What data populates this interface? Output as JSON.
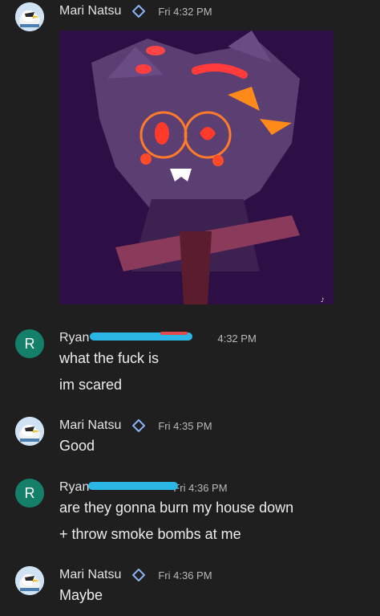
{
  "messages": [
    {
      "sender": "Mari Natsu",
      "time": "Fri 4:32 PM",
      "avatar": "bird-avatar",
      "verified": true,
      "lines": [],
      "attachment": "image"
    },
    {
      "sender": "Ryan",
      "time": "4:32 PM",
      "avatar_letter": "R",
      "lines": [
        "what the fuck is",
        "im scared"
      ]
    },
    {
      "sender": "Mari Natsu",
      "time": "Fri 4:35 PM",
      "avatar": "bird-avatar",
      "verified": true,
      "lines": [
        "Good"
      ]
    },
    {
      "sender": "Ryan",
      "time": "Fri 4:36 PM",
      "avatar_letter": "R",
      "lines": [
        "are they gonna burn my house down",
        "+ throw smoke bombs at me"
      ]
    },
    {
      "sender": "Mari Natsu",
      "time": "Fri 4:36 PM",
      "avatar": "bird-avatar",
      "verified": true,
      "lines": [
        "Maybe"
      ]
    }
  ],
  "colors": {
    "background": "#1f1f1f",
    "accent": "#8ab4f8",
    "ryan_avatar": "#14806a"
  },
  "icons": {
    "verified": "diamond-badge-icon"
  }
}
